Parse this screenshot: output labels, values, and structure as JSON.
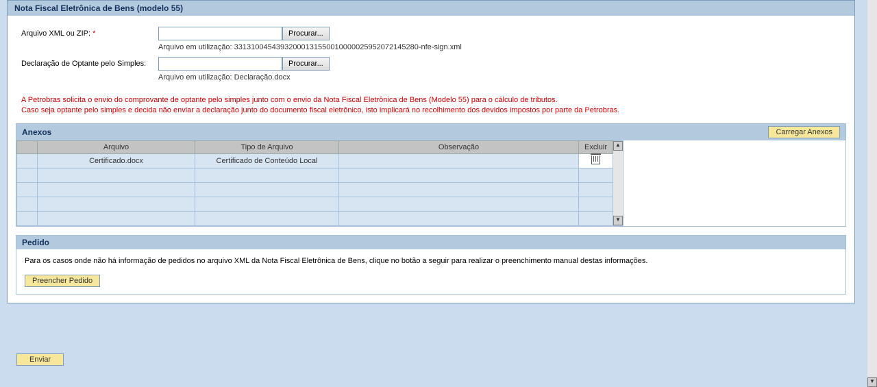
{
  "panel_title": "Nota Fiscal Eletrônica de Bens (modelo 55)",
  "form": {
    "xml_label": "Arquivo XML ou ZIP:",
    "required_mark": "*",
    "browse_label": "Procurar...",
    "xml_use_prefix": "Arquivo em utilização:",
    "xml_use_file": "33131004543932000131550010000025952072145280-nfe-sign.xml",
    "decl_label": "Declaração de Optante pelo Simples:",
    "decl_use_prefix": "Arquivo em utilização:",
    "decl_use_file": "Declaração.docx"
  },
  "warning": "A Petrobras solicita o envio do comprovante de optante pelo simples junto com o envio da Nota Fiscal Eletrônica de Bens (Modelo 55) para o cálculo de tributos.\nCaso seja optante pelo simples e decida não enviar a declaração junto do documento fiscal eletrônico, isto implicará no recolhimento dos devidos impostos por parte da Petrobras.",
  "anexos": {
    "title": "Anexos",
    "load_btn": "Carregar Anexos",
    "cols": {
      "file": "Arquivo",
      "type": "Tipo de Arquivo",
      "obs": "Observação",
      "del": "Excluir"
    },
    "rows": [
      {
        "file": "Certificado.docx",
        "type": "Certificado de Conteúdo Local",
        "obs": ""
      }
    ]
  },
  "pedido": {
    "title": "Pedido",
    "text": "Para os casos onde não há informação de pedidos no arquivo XML da Nota Fiscal Eletrônica de Bens, clique no botão a seguir para realizar o preenchimento manual destas informações.",
    "fill_btn": "Preencher Pedido"
  },
  "submit_btn": "Enviar"
}
